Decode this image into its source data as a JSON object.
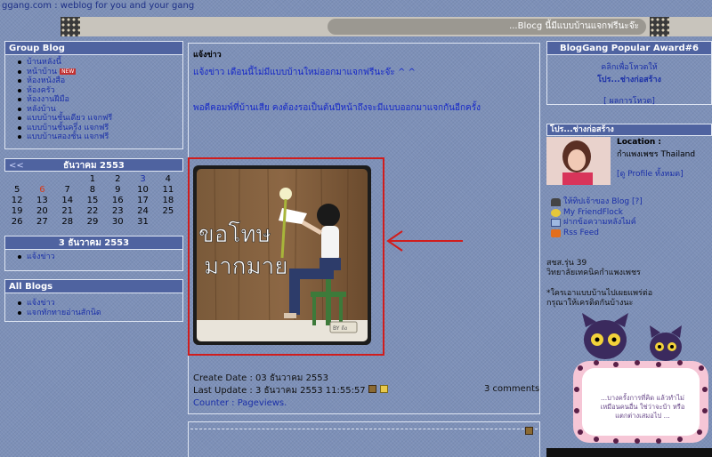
{
  "header": {
    "site_title": "ggang.com : weblog for you and your gang",
    "marquee_text": "...Blocg นี้มีแบบบ้านแจกฟรีนะจ๊ะ"
  },
  "group_blog": {
    "title": "Group Blog",
    "items": [
      {
        "label": "บ้านหลังนี้",
        "badge": ""
      },
      {
        "label": "หน้าบ้าน",
        "badge": "NEW"
      },
      {
        "label": "ห้องหนังสือ",
        "badge": ""
      },
      {
        "label": "ห้องครัว",
        "badge": ""
      },
      {
        "label": "ห้องงานฝีมือ",
        "badge": ""
      },
      {
        "label": "หลังบ้าน",
        "badge": ""
      },
      {
        "label": "แบบบ้านชั้นเดียว แจกฟรี",
        "badge": ""
      },
      {
        "label": "แบบบ้านชั้นครึ่ง แจกฟรี",
        "badge": ""
      },
      {
        "label": "แบบบ้านสองชั้น แจกฟรี",
        "badge": ""
      }
    ]
  },
  "calendar": {
    "prev": "<<",
    "month_label": "ธันวาคม 2553",
    "rows": [
      [
        "",
        "",
        "",
        "1",
        "2",
        "3",
        "4"
      ],
      [
        "5",
        "6",
        "7",
        "8",
        "9",
        "10",
        "11"
      ],
      [
        "12",
        "13",
        "14",
        "15",
        "16",
        "17",
        "18"
      ],
      [
        "19",
        "20",
        "21",
        "22",
        "23",
        "24",
        "25"
      ],
      [
        "26",
        "27",
        "28",
        "29",
        "30",
        "31",
        ""
      ]
    ],
    "today": "6",
    "linked": "3"
  },
  "day_box": {
    "title": "3 ธันวาคม 2553",
    "items": [
      "แจ้งข่าว"
    ]
  },
  "all_blogs": {
    "title": "All Blogs",
    "items": [
      "แจ้งข่าว",
      "แจกทักทายอ่านสักนิด"
    ]
  },
  "entry": {
    "title": "แจ้งข่าว",
    "line1": "แจ้งข่าว เดือนนี้ไม่มีแบบบ้านใหม่ออกมาแจกฟรีนะจ๊ะ ^ ^",
    "line2": "พอดีคอมพ์ที่บ้านเสีย คงต้องรอเป็นต้นปีหน้าถึงจะมีแบบออกมาแจกกันอีกครั้ง",
    "image_text_line1": "ขอโทษ",
    "image_text_line2": "มากมาย",
    "image_tag": "BY ถ้ง",
    "create_date": "Create Date : 03 ธันวาคม 2553",
    "last_update": "Last Update : 3 ธันวาคม 2553 11:55:57 น.",
    "comments": "3 comments",
    "counter": "Counter : Pageviews."
  },
  "award": {
    "title": "BlogGang Popular Award#6",
    "click_vote": "คลิกเพื่อโหวตให้",
    "owner": "โปร...ช่างก่อสร้าง",
    "results_link": "[ ผลการโหวต]"
  },
  "profile": {
    "header": "โปร...ช่างก่อสร้าง",
    "location_label": "Location :",
    "location_value": "กำแพงเพชร Thailand",
    "view_profile": "[ดู Profile ทั้งหมด]",
    "links": [
      {
        "label": "ให้ทิปเจ้าของ Blog [?]",
        "icon": "money-hat-icon"
      },
      {
        "label": "My FriendFlock",
        "icon": "friends-icon"
      },
      {
        "label": "ฝากข้อความหลังไมค์",
        "icon": "message-icon"
      },
      {
        "label": "Rss Feed",
        "icon": "rss-icon"
      }
    ],
    "bio_line1": "สชส.รุ่น 39",
    "bio_line2": "วิทยาลัยเทคนิคกำแพงเพชร",
    "note_line1": "*ใครเอาแบบบ้านไปเผยแพร่ต่อ",
    "note_line2": "กรุณาให้เครดิตกันบ้างนะ",
    "cat_sign_line1": "...บางครั้งการที่คิด แล้วทำไม่",
    "cat_sign_line2": "เหมือนคนอื่น ใช่ว่าจะบ้า หรือ",
    "cat_sign_line3": "แตกต่างเสมอไป ..."
  },
  "colors": {
    "background": "#7d90b8",
    "panel_title": "#4f63a0",
    "link": "#1a2fa8",
    "highlight_frame": "#d01d1d"
  }
}
